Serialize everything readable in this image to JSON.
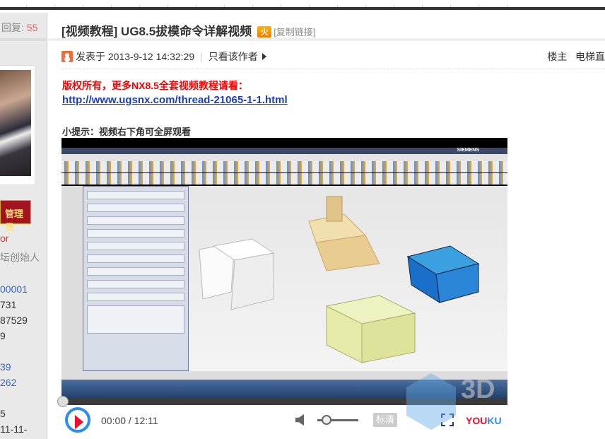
{
  "sidebar": {
    "reply_label": "回复:",
    "reply_count": "55",
    "badge": "管理员",
    "username_fragment": "or",
    "title_fragment": "坛创始人",
    "stats": [
      {
        "text": "00001",
        "color": "#3366cc"
      },
      {
        "text": "731",
        "color": "#333333"
      },
      {
        "text": "87529",
        "color": "#333333"
      },
      {
        "text": "9",
        "color": "#333333"
      },
      {
        "text": "39",
        "color": "#3366cc"
      },
      {
        "text": "262",
        "color": "#3366cc"
      },
      {
        "text": "5",
        "color": "#333333"
      },
      {
        "text": "11-11-",
        "color": "#333333"
      }
    ]
  },
  "thread": {
    "title": "[视频教程] UG8.5拔模命令详解视频",
    "hot_icon": "火",
    "copy_link": "[复制链接]"
  },
  "post": {
    "posted_at": "发表于 2013-9-12 14:32:29",
    "only_author": "只看该作者",
    "floor": "楼主",
    "elevator": "电梯直",
    "copyright": "版权所有，更多NX8.5全套视频教程请看：",
    "link": "http://www.ugsnx.com/thread-21065-1-1.html",
    "tip": "小提示：视频右下角可全屏观看"
  },
  "video": {
    "brand": "SIEMENS",
    "time": "00:00 / 12:11",
    "progress": 0,
    "volume": 0.15,
    "quality": "标清",
    "logo_a": "YOU",
    "logo_b": "KU",
    "watermark": "3D"
  }
}
